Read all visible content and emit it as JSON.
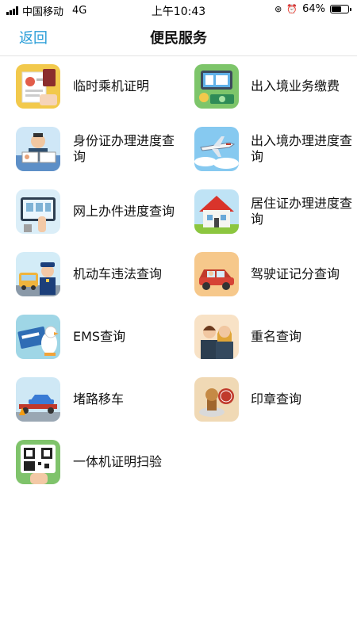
{
  "status_bar": {
    "carrier": "中国移动",
    "network": "4G",
    "time": "上午10:43",
    "battery_percent": "64%",
    "battery_level": 0.64
  },
  "nav": {
    "back_label": "返回",
    "title": "便民服务"
  },
  "services": [
    {
      "label": "临时乘机证明",
      "icon": "boarding-pass-icon"
    },
    {
      "label": "出入境业务缴费",
      "icon": "payment-icon"
    },
    {
      "label": "身份证办理进度查询",
      "icon": "id-card-icon"
    },
    {
      "label": "出入境办理进度查询",
      "icon": "airplane-icon"
    },
    {
      "label": "网上办件进度查询",
      "icon": "online-service-icon"
    },
    {
      "label": "居住证办理进度查询",
      "icon": "house-icon"
    },
    {
      "label": "机动车违法查询",
      "icon": "traffic-police-icon"
    },
    {
      "label": "驾驶证记分查询",
      "icon": "car-driver-icon"
    },
    {
      "label": "EMS查询",
      "icon": "ems-icon"
    },
    {
      "label": "重名查询",
      "icon": "people-icon"
    },
    {
      "label": "堵路移车",
      "icon": "tow-truck-icon"
    },
    {
      "label": "印章查询",
      "icon": "stamp-icon"
    },
    {
      "label": "一体机证明扫验",
      "icon": "qr-scan-icon"
    }
  ]
}
